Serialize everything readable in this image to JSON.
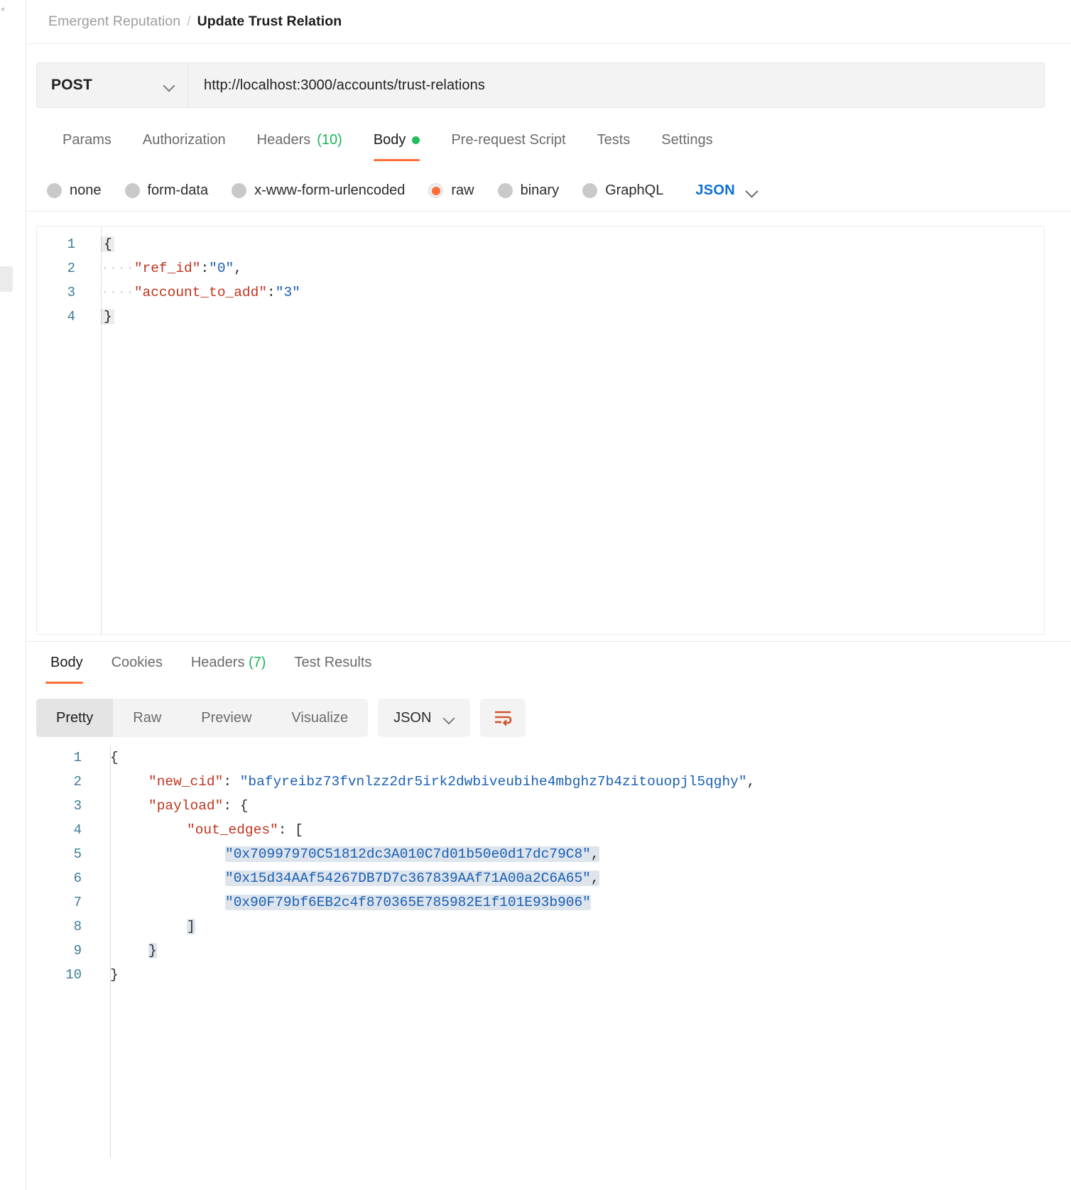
{
  "breadcrumb": {
    "collection": "Emergent Reputation",
    "separator": "/",
    "current": "Update Trust Relation"
  },
  "request": {
    "method": "POST",
    "url": "http://localhost:3000/accounts/trust-relations",
    "tabs": [
      {
        "label": "Params",
        "active": false
      },
      {
        "label": "Authorization",
        "active": false
      },
      {
        "label": "Headers",
        "count": "(10)",
        "active": false
      },
      {
        "label": "Body",
        "active": true,
        "dot": true
      },
      {
        "label": "Pre-request Script",
        "active": false
      },
      {
        "label": "Tests",
        "active": false
      },
      {
        "label": "Settings",
        "active": false
      }
    ],
    "body_types": [
      {
        "label": "none",
        "selected": false
      },
      {
        "label": "form-data",
        "selected": false
      },
      {
        "label": "x-www-form-urlencoded",
        "selected": false
      },
      {
        "label": "raw",
        "selected": true
      },
      {
        "label": "binary",
        "selected": false
      },
      {
        "label": "GraphQL",
        "selected": false
      }
    ],
    "format_selector": "JSON",
    "body_lines": [
      {
        "n": "1",
        "open_brace": "{"
      },
      {
        "n": "2",
        "dots": "····",
        "key": "\"ref_id\"",
        "colon": ":",
        "value": "\"0\"",
        "trail": ","
      },
      {
        "n": "3",
        "dots": "····",
        "key": "\"account_to_add\"",
        "colon": ":",
        "value": "\"3\"",
        "trail": ""
      },
      {
        "n": "4",
        "close_brace": "}"
      }
    ]
  },
  "response": {
    "tabs": [
      {
        "label": "Body",
        "active": true
      },
      {
        "label": "Cookies",
        "active": false
      },
      {
        "label": "Headers",
        "count": "(7)",
        "active": false
      },
      {
        "label": "Test Results",
        "active": false
      }
    ],
    "views": [
      {
        "label": "Pretty",
        "active": true
      },
      {
        "label": "Raw",
        "active": false
      },
      {
        "label": "Preview",
        "active": false
      },
      {
        "label": "Visualize",
        "active": false
      }
    ],
    "format_selector": "JSON",
    "wrap_icon": "wrap-text-icon",
    "accent_color": "#ff6c37",
    "body_lines": [
      {
        "n": "1",
        "segments": [
          {
            "t": "{",
            "c": "punc"
          }
        ],
        "indent": 0,
        "sel": false
      },
      {
        "n": "2",
        "indent": 1,
        "sel": false,
        "segments": [
          {
            "t": "\"new_cid\"",
            "c": "key"
          },
          {
            "t": ": ",
            "c": "punc"
          },
          {
            "t": "\"bafyreibz73fvnlzz2dr5irk2dwbiveubihe4mbghz7b4zitouopjl5qghy\"",
            "c": "val"
          },
          {
            "t": ",",
            "c": "punc"
          }
        ]
      },
      {
        "n": "3",
        "indent": 1,
        "sel": false,
        "segments": [
          {
            "t": "\"payload\"",
            "c": "key"
          },
          {
            "t": ": {",
            "c": "punc"
          }
        ]
      },
      {
        "n": "4",
        "indent": 2,
        "sel": false,
        "segments": [
          {
            "t": "\"out_edges\"",
            "c": "key"
          },
          {
            "t": ": [",
            "c": "punc"
          }
        ]
      },
      {
        "n": "5",
        "indent": 3,
        "sel": true,
        "segments": [
          {
            "t": "\"0x70997970C51812dc3A010C7d01b50e0d17dc79C8\"",
            "c": "val"
          },
          {
            "t": ",",
            "c": "punc"
          }
        ]
      },
      {
        "n": "6",
        "indent": 3,
        "sel": true,
        "segments": [
          {
            "t": "\"0x15d34AAf54267DB7D7c367839AAf71A00a2C6A65\"",
            "c": "val"
          },
          {
            "t": ",",
            "c": "punc"
          }
        ]
      },
      {
        "n": "7",
        "indent": 3,
        "sel": true,
        "segments": [
          {
            "t": "\"0x90F79bf6EB2c4f870365E785982E1f101E93b906\"",
            "c": "val"
          }
        ]
      },
      {
        "n": "8",
        "indent": 2,
        "sel": true,
        "segments": [
          {
            "t": "]",
            "c": "punc"
          }
        ]
      },
      {
        "n": "9",
        "indent": 1,
        "sel": true,
        "segments": [
          {
            "t": "}",
            "c": "punc"
          }
        ]
      },
      {
        "n": "10",
        "indent": 0,
        "sel": false,
        "segments": [
          {
            "t": "}",
            "c": "punc"
          }
        ]
      }
    ]
  }
}
